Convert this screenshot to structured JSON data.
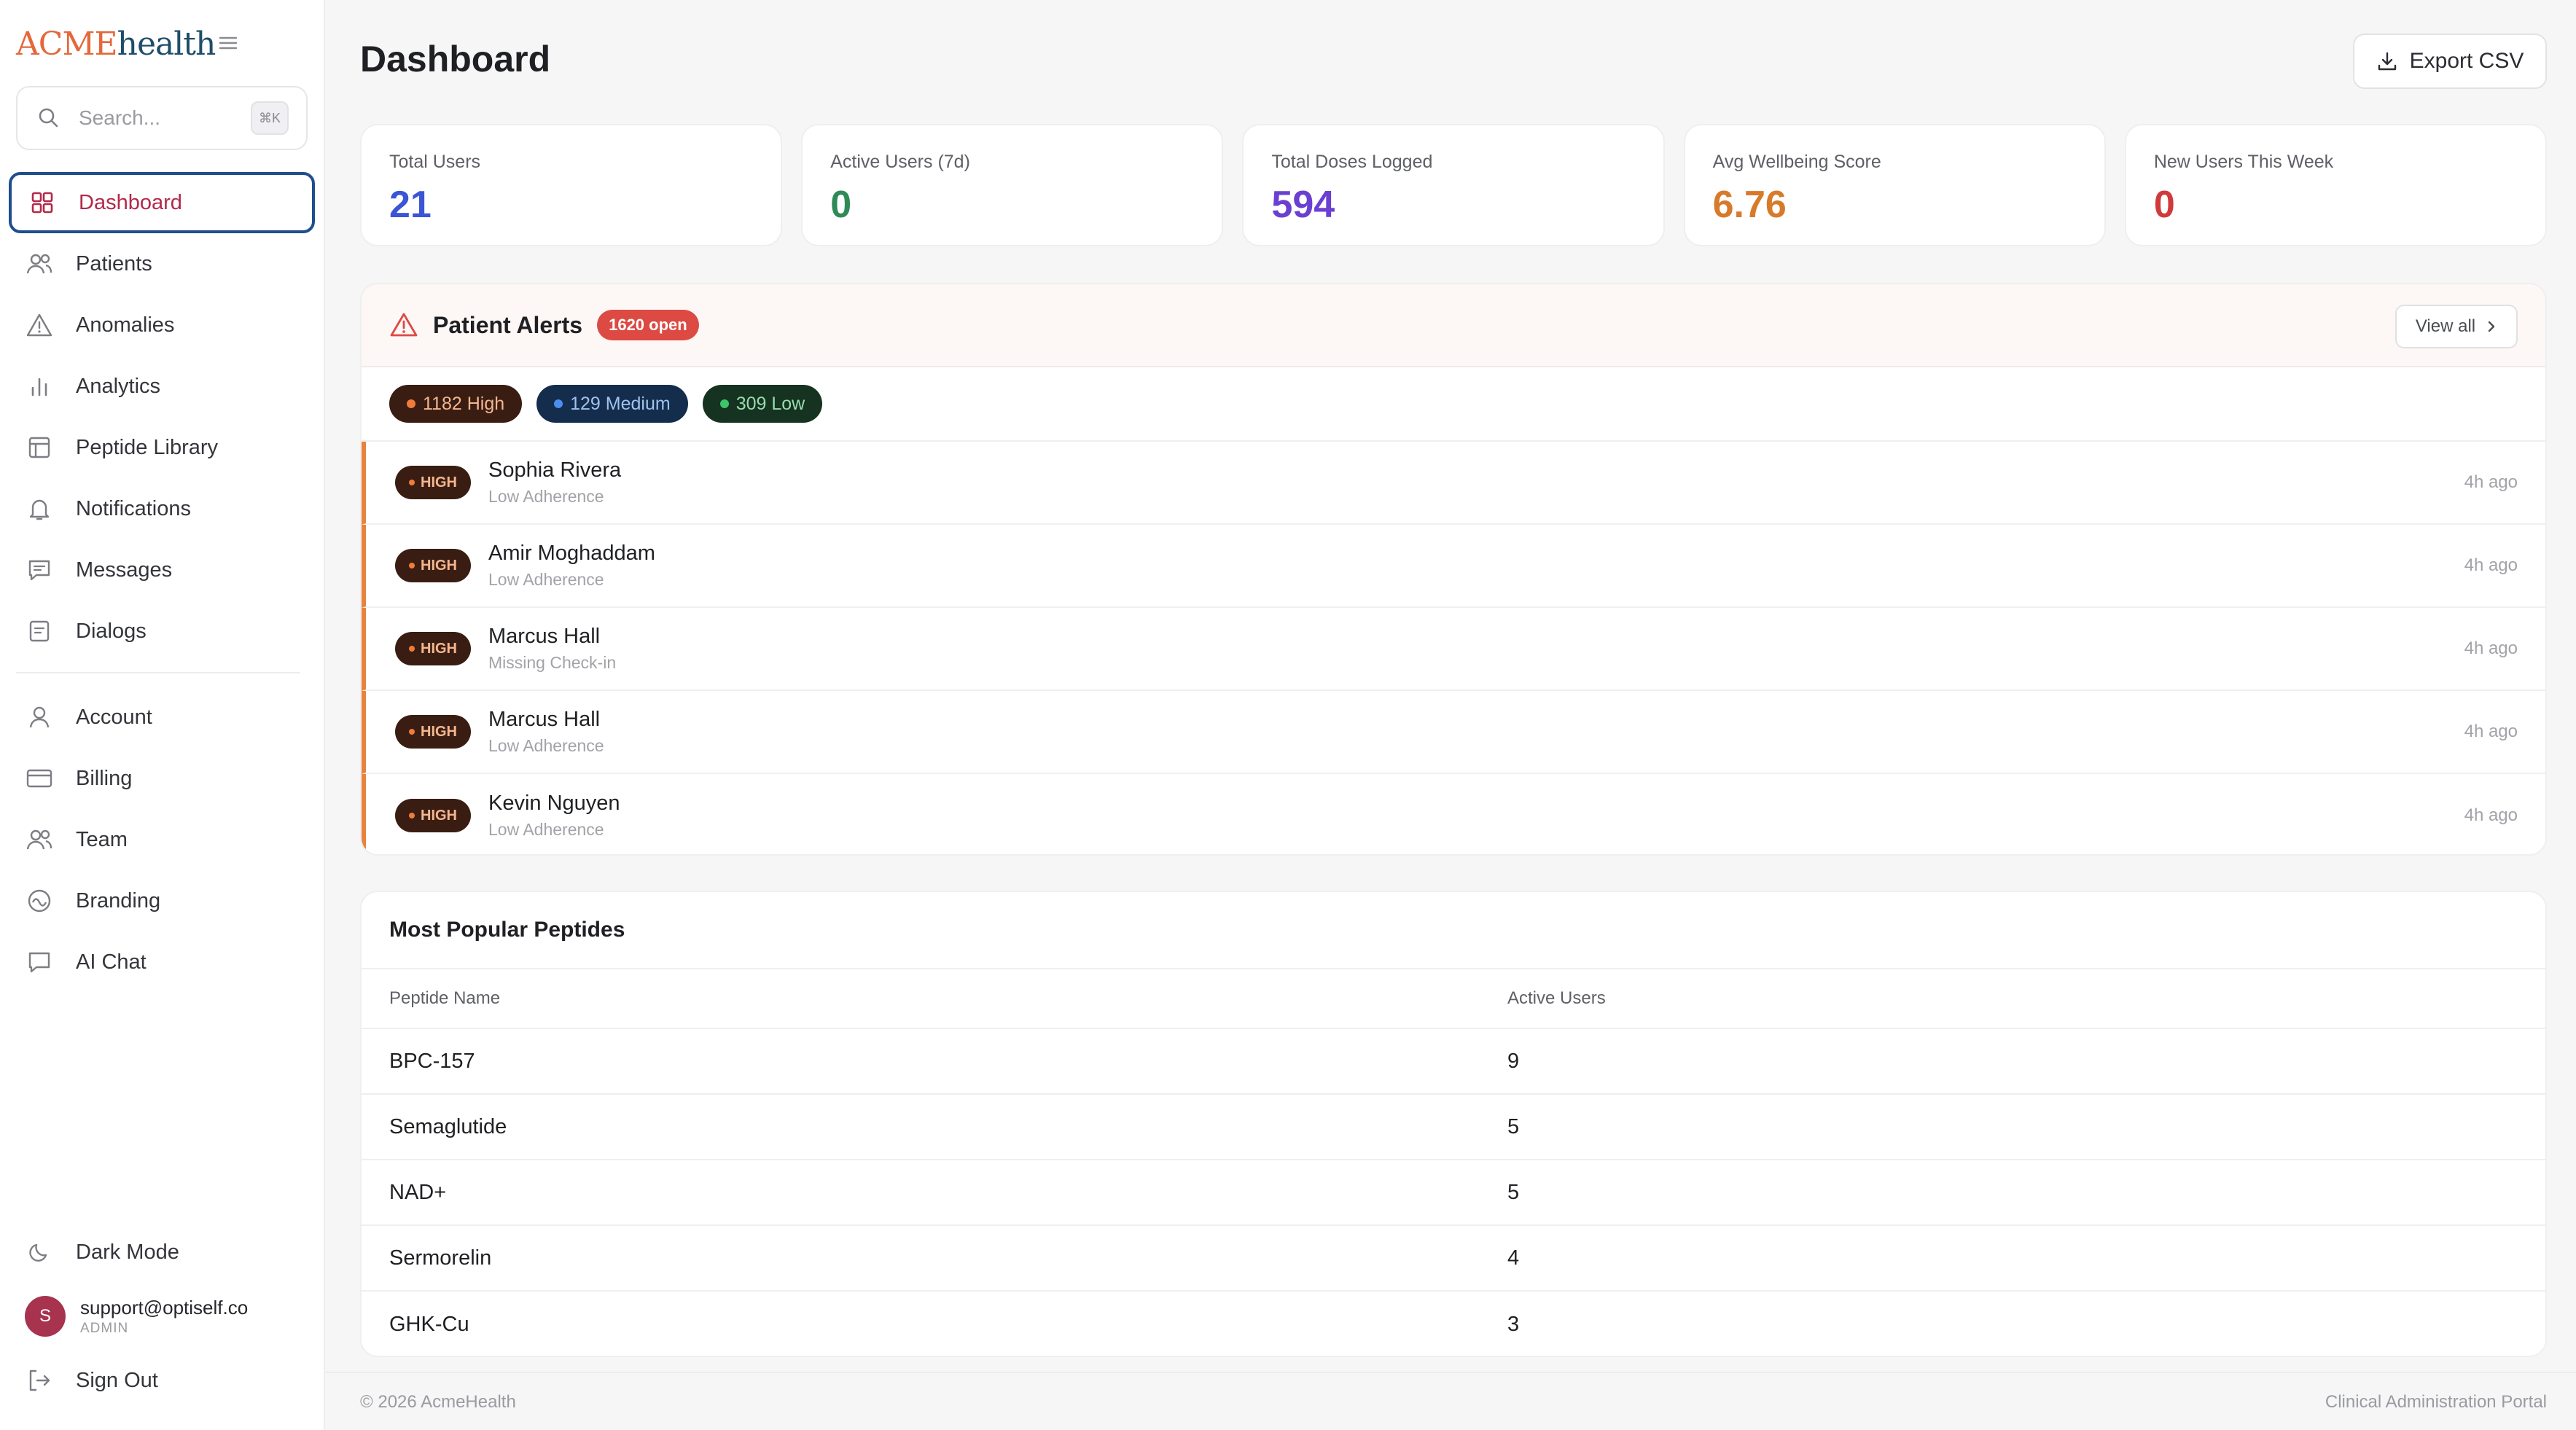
{
  "brand": {
    "part1": "ACME",
    "part2": "health",
    "accent": "#e4683a",
    "secondary": "#1e4e6a"
  },
  "search": {
    "placeholder": "Search...",
    "shortcut": "⌘K"
  },
  "nav": {
    "primary": [
      {
        "label": "Dashboard",
        "icon": "grid-icon",
        "active": true
      },
      {
        "label": "Patients",
        "icon": "users-icon"
      },
      {
        "label": "Anomalies",
        "icon": "warning-icon"
      },
      {
        "label": "Analytics",
        "icon": "bar-chart-icon"
      },
      {
        "label": "Peptide Library",
        "icon": "library-icon"
      },
      {
        "label": "Notifications",
        "icon": "bell-icon"
      },
      {
        "label": "Messages",
        "icon": "message-icon"
      },
      {
        "label": "Dialogs",
        "icon": "document-icon"
      }
    ],
    "secondary": [
      {
        "label": "Account",
        "icon": "user-icon"
      },
      {
        "label": "Billing",
        "icon": "credit-card-icon"
      },
      {
        "label": "Team",
        "icon": "team-icon"
      },
      {
        "label": "Branding",
        "icon": "branding-icon"
      },
      {
        "label": "AI Chat",
        "icon": "chat-icon"
      }
    ]
  },
  "sidebar_bottom": {
    "dark_mode": "Dark Mode",
    "user": {
      "initial": "S",
      "email": "support@optiself.co",
      "role": "ADMIN"
    },
    "sign_out": "Sign Out"
  },
  "header": {
    "title": "Dashboard",
    "export_label": "Export CSV"
  },
  "stats": [
    {
      "label": "Total Users",
      "value": "21",
      "color": "#3b55d6"
    },
    {
      "label": "Active Users (7d)",
      "value": "0",
      "color": "#2e8a57"
    },
    {
      "label": "Total Doses Logged",
      "value": "594",
      "color": "#6a3fd1"
    },
    {
      "label": "Avg Wellbeing Score",
      "value": "6.76",
      "color": "#d77a2a"
    },
    {
      "label": "New Users This Week",
      "value": "0",
      "color": "#d03a3a"
    }
  ],
  "alerts": {
    "title": "Patient Alerts",
    "open_badge": "1620 open",
    "view_all": "View all",
    "filters": {
      "high": "1182 High",
      "medium": "129 Medium",
      "low": "309 Low"
    },
    "rows": [
      {
        "severity": "HIGH",
        "name": "Sophia Rivera",
        "type": "Low Adherence",
        "time": "4h ago"
      },
      {
        "severity": "HIGH",
        "name": "Amir Moghaddam",
        "type": "Low Adherence",
        "time": "4h ago"
      },
      {
        "severity": "HIGH",
        "name": "Marcus Hall",
        "type": "Missing Check-in",
        "time": "4h ago"
      },
      {
        "severity": "HIGH",
        "name": "Marcus Hall",
        "type": "Low Adherence",
        "time": "4h ago"
      },
      {
        "severity": "HIGH",
        "name": "Kevin Nguyen",
        "type": "Low Adherence",
        "time": "4h ago"
      }
    ]
  },
  "peptides": {
    "title": "Most Popular Peptides",
    "columns": [
      "Peptide Name",
      "Active Users"
    ],
    "rows": [
      {
        "name": "BPC-157",
        "users": "9"
      },
      {
        "name": "Semaglutide",
        "users": "5"
      },
      {
        "name": "NAD+",
        "users": "5"
      },
      {
        "name": "Sermorelin",
        "users": "4"
      },
      {
        "name": "GHK-Cu",
        "users": "3"
      }
    ]
  },
  "footer": {
    "left": "© 2026 AcmeHealth",
    "right": "Clinical Administration Portal"
  }
}
